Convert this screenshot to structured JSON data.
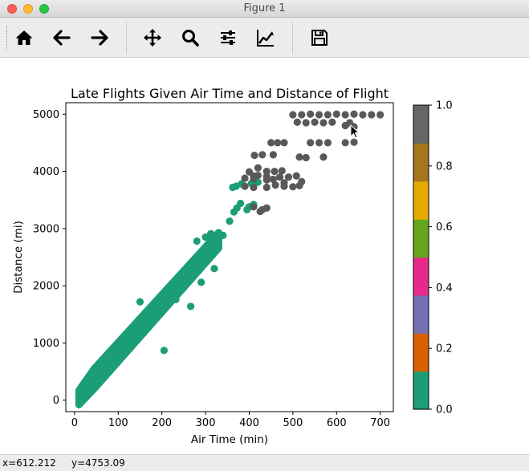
{
  "window": {
    "title": "Figure 1"
  },
  "toolbar": {
    "buttons": [
      {
        "id": "home",
        "icon": "home-icon"
      },
      {
        "id": "back",
        "icon": "arrow-left-icon"
      },
      {
        "id": "forward",
        "icon": "arrow-right-icon"
      },
      {
        "id": "pan",
        "icon": "move-arrows-icon"
      },
      {
        "id": "zoom",
        "icon": "magnifier-icon"
      },
      {
        "id": "subplots",
        "icon": "sliders-icon"
      },
      {
        "id": "edit-axes",
        "icon": "line-chart-icon"
      },
      {
        "id": "save",
        "icon": "floppy-disk-icon"
      }
    ]
  },
  "status": {
    "x": "x=612.212",
    "y": "y=4753.09"
  },
  "chart_data": {
    "type": "scatter",
    "title": "Late Flights Given Air Time and Distance of Flight",
    "xlabel": "Air Time (min)",
    "ylabel": "Distance (mi)",
    "xlim": [
      -20,
      730
    ],
    "ylim": [
      -200,
      5200
    ],
    "xticks": [
      0,
      100,
      200,
      300,
      400,
      500,
      600,
      700
    ],
    "yticks": [
      0,
      1000,
      2000,
      3000,
      4000,
      5000
    ],
    "colorbar": {
      "range": [
        0.0,
        1.0
      ],
      "ticks": [
        "0.0",
        "0.2",
        "0.4",
        "0.6",
        "0.8",
        "1.0"
      ],
      "colors": [
        "#1b9e77",
        "#d95f02",
        "#7570b3",
        "#e7298a",
        "#66a61e",
        "#e6ab02",
        "#a6761d",
        "#666666"
      ]
    },
    "series": [
      {
        "value": 0.0,
        "color": "#1b9e77",
        "band": {
          "x_start": [
            10,
            45
          ],
          "x_end": [
            45,
            330
          ],
          "slope_x": 0.085,
          "slope_y": 0.15
        },
        "points": [
          [
            150,
            1720
          ],
          [
            205,
            870
          ],
          [
            266,
            1640
          ],
          [
            232,
            1760
          ],
          [
            290,
            2060
          ],
          [
            320,
            2300
          ],
          [
            340,
            2880
          ],
          [
            355,
            3130
          ],
          [
            365,
            3290
          ],
          [
            380,
            3440
          ],
          [
            400,
            3380
          ],
          [
            410,
            3420
          ],
          [
            395,
            3330
          ],
          [
            372,
            3360
          ],
          [
            362,
            3720
          ],
          [
            370,
            3740
          ],
          [
            382,
            3780
          ],
          [
            405,
            3790
          ],
          [
            420,
            3810
          ],
          [
            330,
            2920
          ],
          [
            312,
            2910
          ],
          [
            300,
            2850
          ],
          [
            280,
            2780
          ]
        ]
      },
      {
        "value": 1.0,
        "color": "#595959",
        "points": [
          [
            500,
            4990
          ],
          [
            520,
            4990
          ],
          [
            540,
            5000
          ],
          [
            560,
            4990
          ],
          [
            580,
            4990
          ],
          [
            600,
            5000
          ],
          [
            620,
            4990
          ],
          [
            640,
            5000
          ],
          [
            660,
            4990
          ],
          [
            680,
            4990
          ],
          [
            700,
            4990
          ],
          [
            510,
            4860
          ],
          [
            530,
            4850
          ],
          [
            550,
            4860
          ],
          [
            570,
            4850
          ],
          [
            590,
            4860
          ],
          [
            630,
            4850
          ],
          [
            620,
            4800
          ],
          [
            640,
            4780
          ],
          [
            450,
            4500
          ],
          [
            465,
            4500
          ],
          [
            480,
            4500
          ],
          [
            540,
            4500
          ],
          [
            560,
            4500
          ],
          [
            580,
            4500
          ],
          [
            620,
            4500
          ],
          [
            640,
            4510
          ],
          [
            412,
            4280
          ],
          [
            430,
            4290
          ],
          [
            455,
            4290
          ],
          [
            515,
            4250
          ],
          [
            570,
            4250
          ],
          [
            420,
            4060
          ],
          [
            440,
            4000
          ],
          [
            458,
            4000
          ],
          [
            475,
            4010
          ],
          [
            530,
            4240
          ],
          [
            400,
            3990
          ],
          [
            410,
            3920
          ],
          [
            420,
            3930
          ],
          [
            440,
            3910
          ],
          [
            470,
            3900
          ],
          [
            490,
            3900
          ],
          [
            508,
            3920
          ],
          [
            390,
            3880
          ],
          [
            410,
            3870
          ],
          [
            440,
            3850
          ],
          [
            455,
            3860
          ],
          [
            480,
            3800
          ],
          [
            390,
            3740
          ],
          [
            410,
            3720
          ],
          [
            440,
            3720
          ],
          [
            460,
            3760
          ],
          [
            480,
            3740
          ],
          [
            500,
            3730
          ],
          [
            515,
            3750
          ],
          [
            520,
            3820
          ],
          [
            410,
            3380
          ],
          [
            430,
            3330
          ],
          [
            440,
            3360
          ],
          [
            425,
            3300
          ]
        ]
      }
    ]
  }
}
